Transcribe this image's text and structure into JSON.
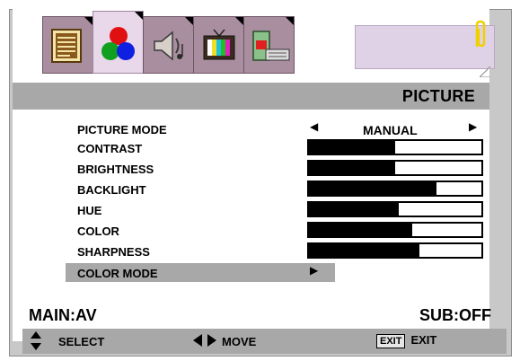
{
  "tabs": [
    {
      "name": "picture-notes-icon",
      "active": false
    },
    {
      "name": "color-balls-icon",
      "active": true
    },
    {
      "name": "speaker-icon",
      "active": false
    },
    {
      "name": "tv-icon",
      "active": false
    },
    {
      "name": "computer-icon",
      "active": false
    }
  ],
  "header": {
    "title": "PICTURE"
  },
  "menu": {
    "picture_mode_label": "PICTURE  MODE",
    "picture_mode_value": "MANUAL",
    "items": [
      {
        "label": "CONTRAST",
        "level": 0.5
      },
      {
        "label": "BRIGHTNESS",
        "level": 0.5
      },
      {
        "label": "BACKLIGHT",
        "level": 0.74
      },
      {
        "label": "HUE",
        "level": 0.52
      },
      {
        "label": "COLOR",
        "level": 0.6
      },
      {
        "label": "SHARPNESS",
        "level": 0.64
      }
    ],
    "color_mode_label": "COLOR MODE"
  },
  "source": {
    "main": "MAIN:AV",
    "sub": "SUB:OFF"
  },
  "footer": {
    "select": "SELECT",
    "move": "MOVE",
    "exit_key": "EXIT",
    "exit": "EXIT"
  },
  "colors": {
    "panel": "#c8c8c8",
    "band": "#a8a8a8",
    "active_tab": "#e9d7ea",
    "inactive_tab": "#a98ea0"
  }
}
